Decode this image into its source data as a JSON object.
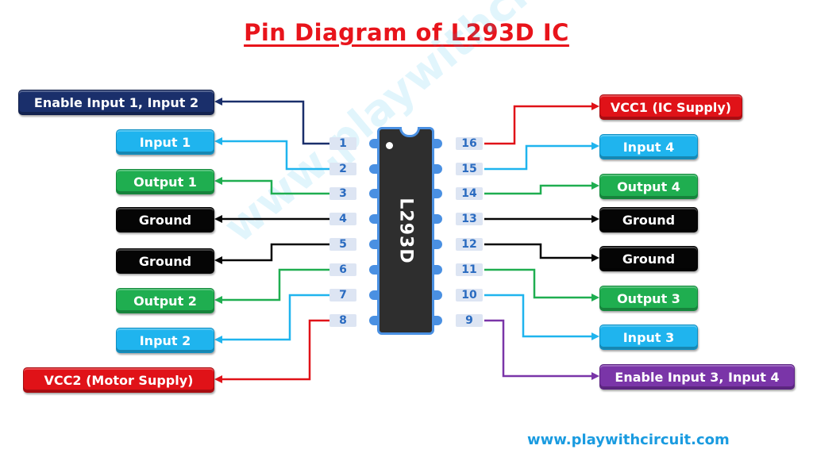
{
  "title": "Pin Diagram of L293D IC",
  "chip": {
    "name": "L293D"
  },
  "colors": {
    "navy": "#1a2f6b",
    "cyan": "#1fb4ee",
    "green": "#1fae50",
    "black": "#050505",
    "red": "#e01218",
    "purple": "#7a35a8",
    "title": "#e8141b",
    "chip_body": "#2e2e2e",
    "chip_leads": "#4a90e2"
  },
  "left_pins": [
    {
      "pin": "1",
      "label": "Enable Input 1, Input 2",
      "color": "navy"
    },
    {
      "pin": "2",
      "label": "Input 1",
      "color": "cyan"
    },
    {
      "pin": "3",
      "label": "Output 1",
      "color": "green"
    },
    {
      "pin": "4",
      "label": "Ground",
      "color": "black"
    },
    {
      "pin": "5",
      "label": "Ground",
      "color": "black"
    },
    {
      "pin": "6",
      "label": "Output 2",
      "color": "green"
    },
    {
      "pin": "7",
      "label": "Input 2",
      "color": "cyan"
    },
    {
      "pin": "8",
      "label": "VCC2 (Motor Supply)",
      "color": "red"
    }
  ],
  "right_pins": [
    {
      "pin": "16",
      "label": "VCC1 (IC Supply)",
      "color": "red"
    },
    {
      "pin": "15",
      "label": "Input 4",
      "color": "cyan"
    },
    {
      "pin": "14",
      "label": "Output 4",
      "color": "green"
    },
    {
      "pin": "13",
      "label": "Ground",
      "color": "black"
    },
    {
      "pin": "12",
      "label": "Ground",
      "color": "black"
    },
    {
      "pin": "11",
      "label": "Output 3",
      "color": "green"
    },
    {
      "pin": "10",
      "label": "Input 3",
      "color": "cyan"
    },
    {
      "pin": "9",
      "label": "Enable Input 3, Input 4",
      "color": "purple"
    }
  ],
  "watermark": "www.playwithcircuit.com",
  "footer_url": "www.playwithcircuit.com"
}
